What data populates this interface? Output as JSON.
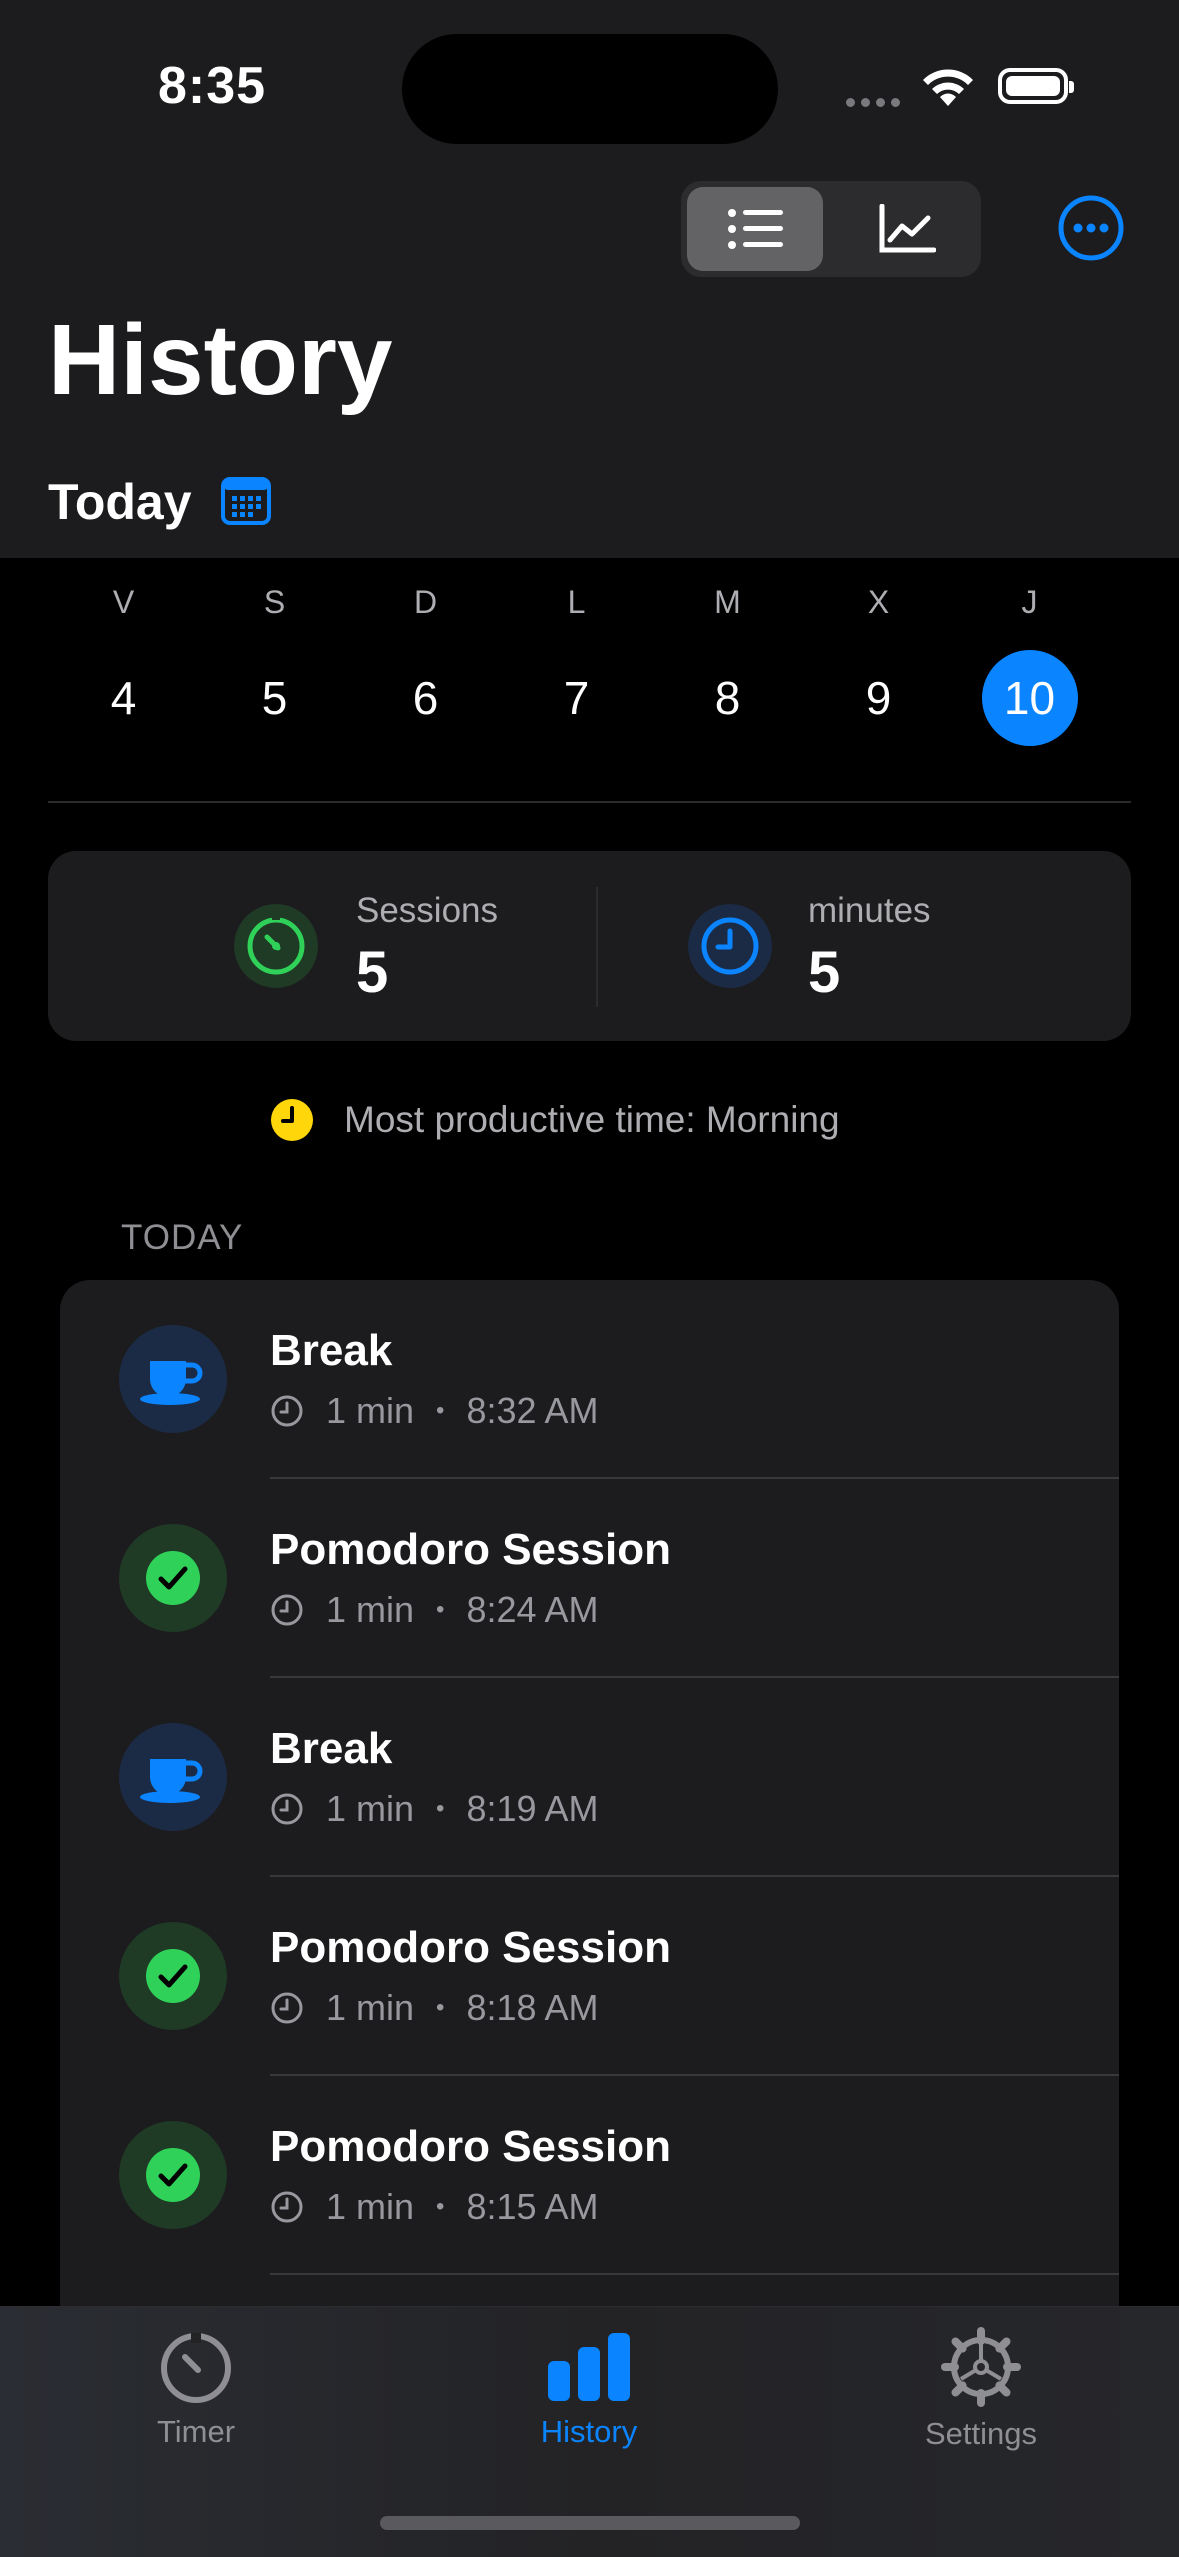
{
  "status_bar": {
    "time": "8:35"
  },
  "header": {
    "title": "History",
    "date_label": "Today"
  },
  "view_toggle": {
    "list_icon": "list-icon",
    "chart_icon": "chart-icon"
  },
  "week": [
    {
      "letter": "V",
      "num": "4"
    },
    {
      "letter": "S",
      "num": "5"
    },
    {
      "letter": "D",
      "num": "6"
    },
    {
      "letter": "L",
      "num": "7"
    },
    {
      "letter": "M",
      "num": "8"
    },
    {
      "letter": "X",
      "num": "9"
    },
    {
      "letter": "J",
      "num": "10",
      "selected": true
    }
  ],
  "stats": {
    "sessions_label": "Sessions",
    "sessions_value": "5",
    "minutes_label": "minutes",
    "minutes_value": "5"
  },
  "insight": "Most productive time: Morning",
  "section": "TODAY",
  "sessions": [
    {
      "type": "break",
      "title": "Break",
      "duration": "1 min",
      "time": "8:32 AM"
    },
    {
      "type": "pomodoro",
      "title": "Pomodoro Session",
      "duration": "1 min",
      "time": "8:24 AM"
    },
    {
      "type": "break",
      "title": "Break",
      "duration": "1 min",
      "time": "8:19 AM"
    },
    {
      "type": "pomodoro",
      "title": "Pomodoro Session",
      "duration": "1 min",
      "time": "8:18 AM"
    },
    {
      "type": "pomodoro",
      "title": "Pomodoro Session",
      "duration": "1 min",
      "time": "8:15 AM"
    }
  ],
  "tabs": [
    {
      "label": "Timer"
    },
    {
      "label": "History"
    },
    {
      "label": "Settings"
    }
  ],
  "colors": {
    "accent": "#0a84ff",
    "green": "#30d158",
    "yellow": "#ffd60a"
  }
}
